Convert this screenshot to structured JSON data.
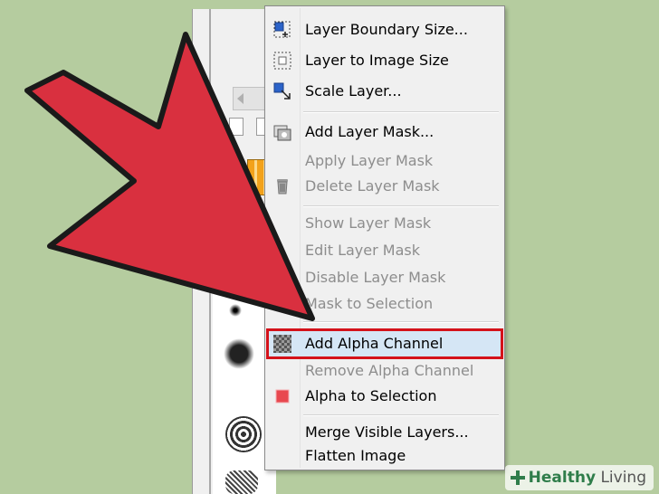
{
  "menu": {
    "items": [
      {
        "label": "Layer Boundary Size...",
        "enabled": true,
        "icon": "layer-boundary-icon"
      },
      {
        "label": "Layer to Image Size",
        "enabled": true,
        "icon": "layer-to-image-icon"
      },
      {
        "label": "Scale Layer...",
        "enabled": true,
        "icon": "scale-layer-icon"
      },
      {
        "label": "Add Layer Mask...",
        "enabled": true,
        "icon": "add-mask-icon"
      },
      {
        "label": "Apply Layer Mask",
        "enabled": false,
        "icon": ""
      },
      {
        "label": "Delete Layer Mask",
        "enabled": false,
        "icon": "trash-icon"
      },
      {
        "label": "Show Layer Mask",
        "enabled": false,
        "icon": ""
      },
      {
        "label": "Edit Layer Mask",
        "enabled": false,
        "icon": ""
      },
      {
        "label": "Disable Layer Mask",
        "enabled": false,
        "icon": ""
      },
      {
        "label": "Mask to Selection",
        "enabled": false,
        "icon": ""
      },
      {
        "label": "Add Alpha Channel",
        "enabled": true,
        "icon": "checkerboard-icon",
        "highlighted": true
      },
      {
        "label": "Remove Alpha Channel",
        "enabled": false,
        "icon": ""
      },
      {
        "label": "Alpha to Selection",
        "enabled": true,
        "icon": "alpha-selection-icon"
      },
      {
        "label": "Merge Visible Layers...",
        "enabled": true,
        "icon": ""
      },
      {
        "label": "Flatten Image",
        "enabled": true,
        "icon": ""
      }
    ]
  },
  "colors": {
    "background": "#b5cc9f",
    "arrow": "#d9303f",
    "highlight_border": "#d4121a",
    "highlight_fill": "#d5e6f5"
  },
  "watermark": {
    "brand": "Healthy",
    "brand2": " Living"
  }
}
